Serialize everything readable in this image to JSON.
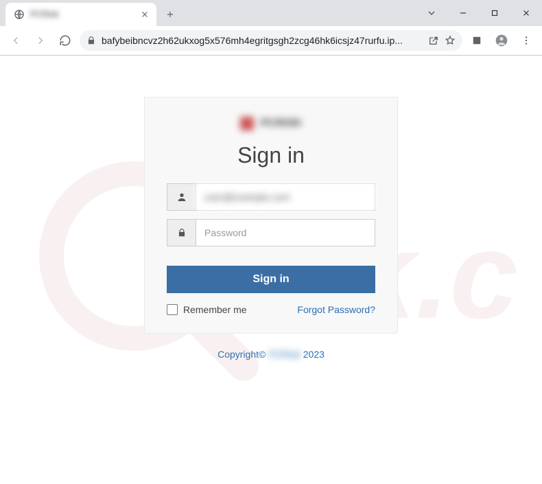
{
  "window": {
    "tab_title": "PCRisk"
  },
  "toolbar": {
    "url": "bafybeibncvz2h62ukxog5x576mh4egritgsgh2zcg46hk6icsjz47rurfu.ip..."
  },
  "page": {
    "brand_text": "PCRISK",
    "heading": "Sign in",
    "email_value": "user@example.com",
    "password_placeholder": "Password",
    "signin_button": "Sign in",
    "remember_label": "Remember me",
    "forgot_label": "Forgot Password?",
    "copyright_prefix": "Copyright© ",
    "copyright_brand": "PCRisk",
    "copyright_year": " 2023"
  }
}
